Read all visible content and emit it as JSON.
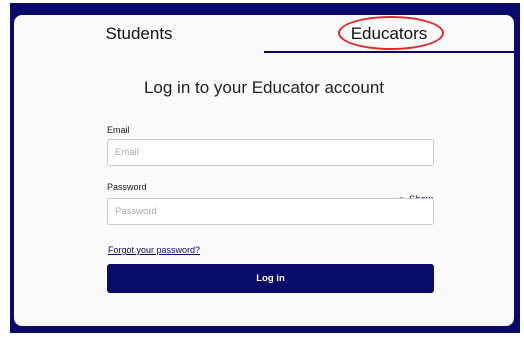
{
  "tabs": [
    {
      "label": "Students",
      "active": false
    },
    {
      "label": "Educators",
      "active": true
    }
  ],
  "heading": "Log in to your Educator account",
  "form": {
    "email_label": "Email",
    "email_placeholder": "Email",
    "password_label": "Password",
    "password_placeholder": "Password",
    "show_label": "Show",
    "forgot_label": "Forgot your password?",
    "login_label": "Log in"
  },
  "colors": {
    "primary": "#0a0a6b",
    "highlight": "#e02828",
    "background": "#fafafa"
  }
}
